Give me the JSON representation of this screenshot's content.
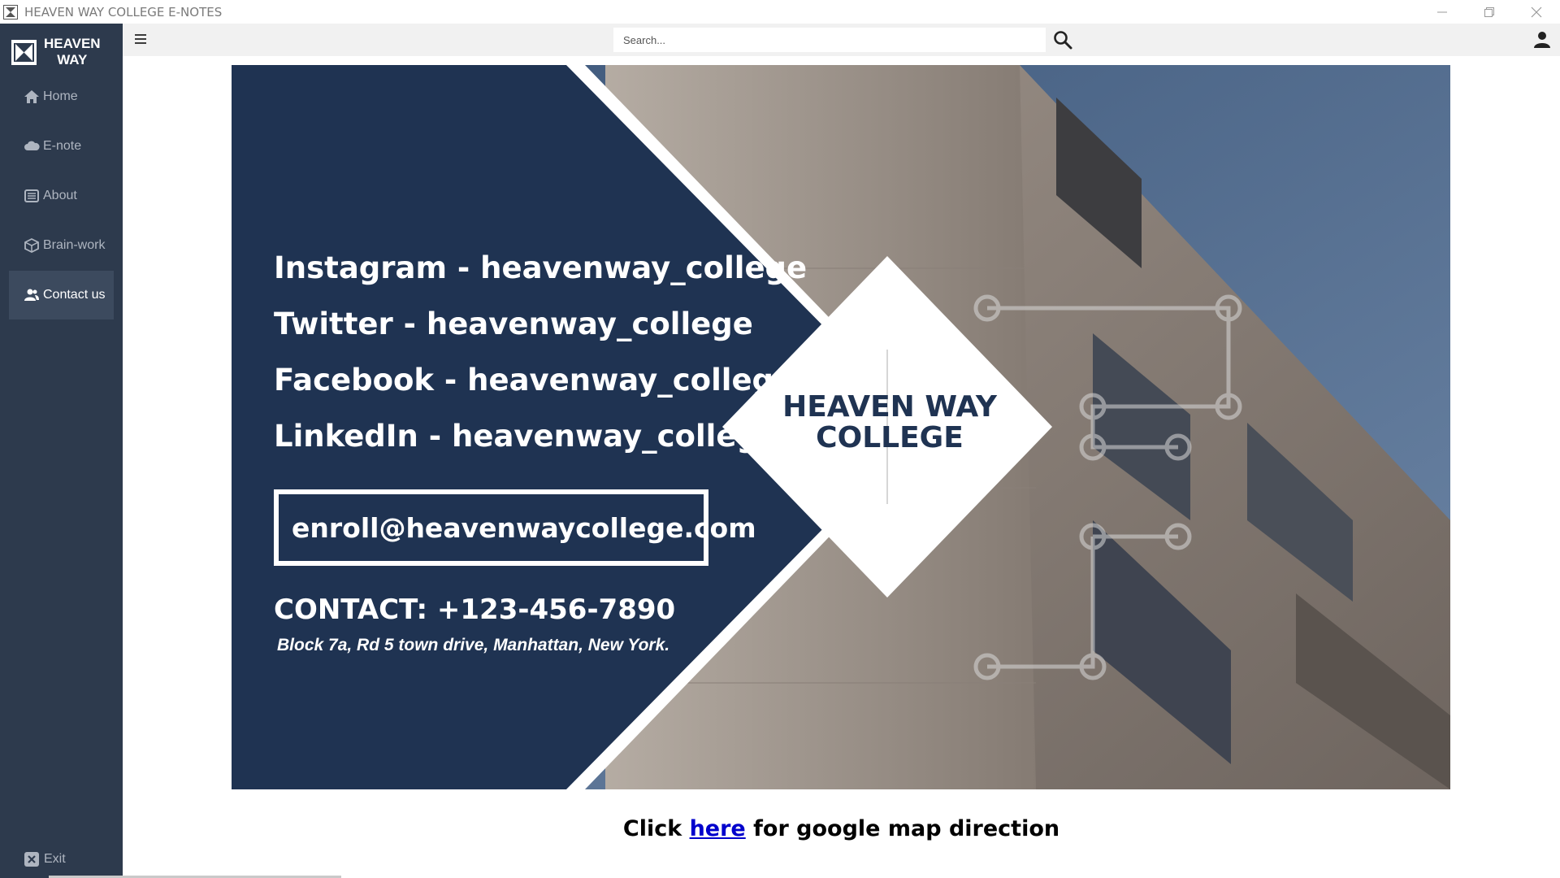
{
  "window": {
    "title": "HEAVEN WAY COLLEGE E-NOTES",
    "controls": [
      "minimize",
      "restore",
      "close"
    ]
  },
  "sidebar": {
    "brand": {
      "line1": "HEAVEN",
      "line2": "WAY"
    },
    "items": [
      {
        "label": "Home",
        "icon": "home-icon",
        "active": false
      },
      {
        "label": "E-note",
        "icon": "cloud-icon",
        "active": false
      },
      {
        "label": "About",
        "icon": "list-icon",
        "active": false
      },
      {
        "label": "Brain-work",
        "icon": "box-icon",
        "active": false
      },
      {
        "label": "Contact us",
        "icon": "users-icon",
        "active": true
      }
    ],
    "exit": {
      "label": "Exit",
      "icon": "close-box-icon"
    }
  },
  "topbar": {
    "search": {
      "placeholder": "Search...",
      "value": ""
    }
  },
  "banner": {
    "social": [
      "Instagram - heavenway_college",
      "Twitter - heavenway_college",
      "Facebook - heavenway_college",
      "LinkedIn - heavenway_college"
    ],
    "email": "enroll@heavenwaycollege.com",
    "contact": "CONTACT:  +123-456-7890",
    "address": "Block 7a, Rd 5 town drive, Manhattan, New York.",
    "college_name_line1": "HEAVEN WAY",
    "college_name_line2": "COLLEGE"
  },
  "map": {
    "prefix": "Click",
    "link": "here",
    "suffix": "for google map direction"
  },
  "colors": {
    "sidebar_bg": "#2d3a4d",
    "banner_navy": "#1f3352",
    "link": "#0000cc"
  }
}
